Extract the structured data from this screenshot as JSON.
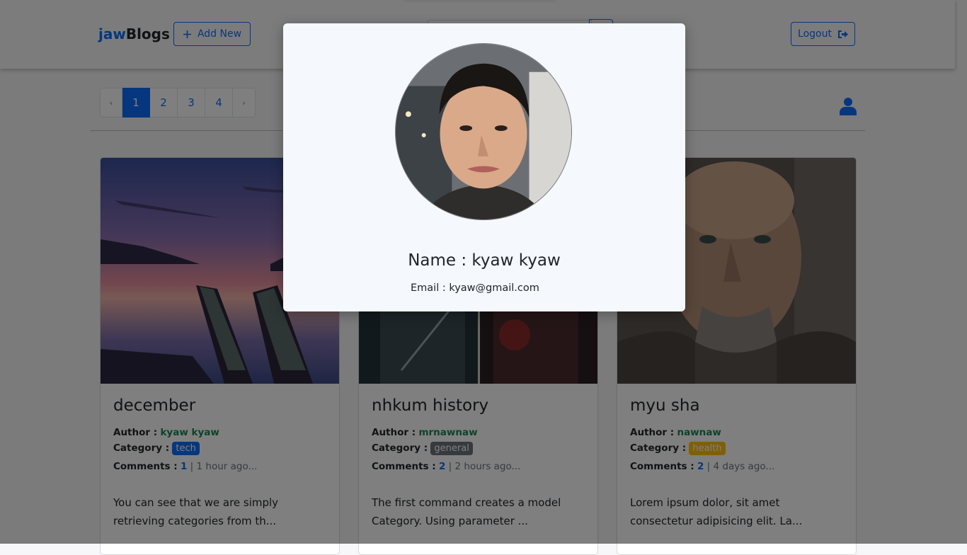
{
  "navbar": {
    "brand_accent": "jaw",
    "brand_rest": "Blogs",
    "add_new_label": "Add New",
    "logout_label": "Logout"
  },
  "pagination": {
    "prev": "‹",
    "pages": [
      "1",
      "2",
      "3",
      "4"
    ],
    "next": "›",
    "active_page": "1"
  },
  "posts": [
    {
      "title": "december",
      "author_label": "Author :",
      "author": "kyaw kyaw",
      "category_label": "Category :",
      "category": "tech",
      "category_color": "#0d6efd",
      "comments_label": "Comments :",
      "comments": "1",
      "time": "| 1 hour ago...",
      "excerpt": "You can see that we are simply retrieving categories from th..."
    },
    {
      "title": "nhkum history",
      "author_label": "Author :",
      "author": "mrnawnaw",
      "category_label": "Category :",
      "category": "general",
      "category_color": "#6c757d",
      "comments_label": "Comments :",
      "comments": "2",
      "time": "| 2 hours ago...",
      "excerpt": "The first command creates a model Category. Using parameter ..."
    },
    {
      "title": "myu sha",
      "author_label": "Author :",
      "author": "nawnaw",
      "category_label": "Category :",
      "category": "health",
      "category_color": "#ffc107",
      "comments_label": "Comments :",
      "comments": "2",
      "time": "| 4 days ago...",
      "excerpt": "Lorem ipsum dolor, sit amet consectetur adipisicing elit. La..."
    }
  ],
  "modal": {
    "name_line": "Name : kyaw kyaw",
    "email_line": "Email : kyaw@gmail.com"
  },
  "colors": {
    "primary": "#0d6efd",
    "author": "#198754"
  }
}
